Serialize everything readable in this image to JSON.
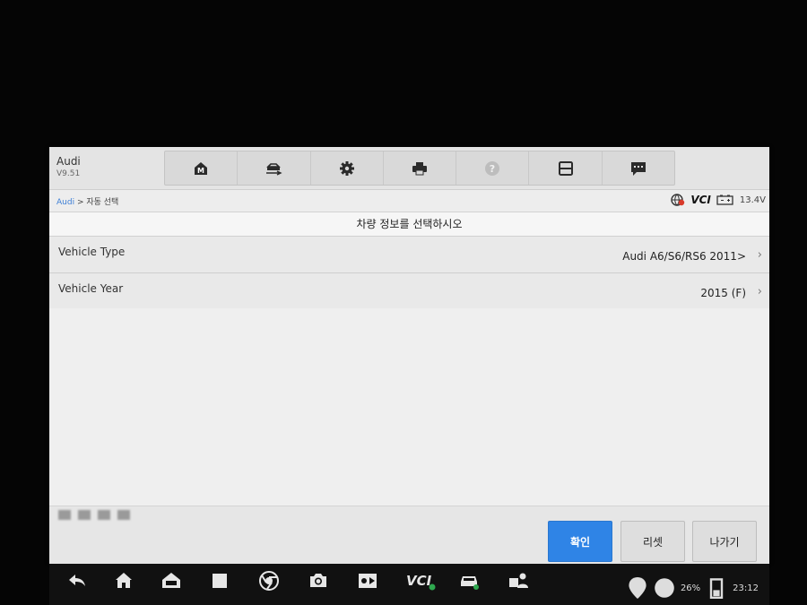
{
  "app": {
    "name": "Audi",
    "version": "V9.51"
  },
  "toolbar": {
    "icons": [
      "home-m-icon",
      "vehicle-swap-icon",
      "settings-icon",
      "print-icon",
      "help-icon",
      "save-icon",
      "message-icon"
    ]
  },
  "breadcrumb": {
    "root": "Audi",
    "separator": " > ",
    "current": "자동 선택"
  },
  "status": {
    "vci": "VCI",
    "voltage": "13.4V"
  },
  "page": {
    "title": "차량 정보를 선택하시오"
  },
  "rows": [
    {
      "label": "Vehicle Type",
      "value": "Audi A6/S6/RS6 2011>"
    },
    {
      "label": "Vehicle Year",
      "value": "2015 (F)"
    }
  ],
  "buttons": {
    "ok": "확인",
    "reset": "리셋",
    "exit": "나가기"
  },
  "system": {
    "battery": "26%",
    "time": "23:12"
  },
  "colors": {
    "accent": "#2f84e6",
    "link": "#3d7fd6"
  }
}
